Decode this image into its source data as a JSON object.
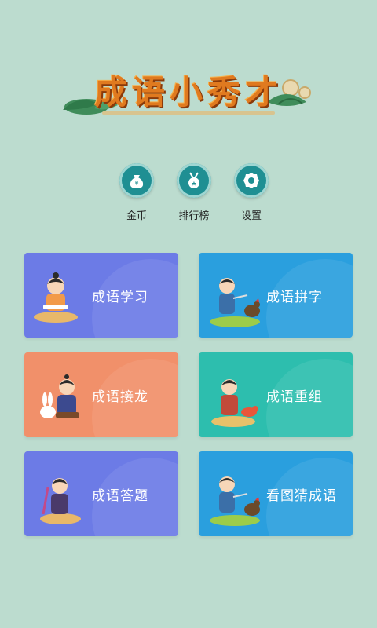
{
  "title": "成语小秀才",
  "top_menu": [
    {
      "label": "金币",
      "icon": "money-bag-icon"
    },
    {
      "label": "排行榜",
      "icon": "medal-icon"
    },
    {
      "label": "设置",
      "icon": "gear-icon"
    }
  ],
  "cards": [
    {
      "label": "成语学习",
      "color": "#6c7be6"
    },
    {
      "label": "成语拼字",
      "color": "#2a9fde"
    },
    {
      "label": "成语接龙",
      "color": "#f1906a"
    },
    {
      "label": "成语重组",
      "color": "#2dbeae"
    },
    {
      "label": "成语答题",
      "color": "#6c7be6"
    },
    {
      "label": "看图猜成语",
      "color": "#2a9fde"
    }
  ]
}
